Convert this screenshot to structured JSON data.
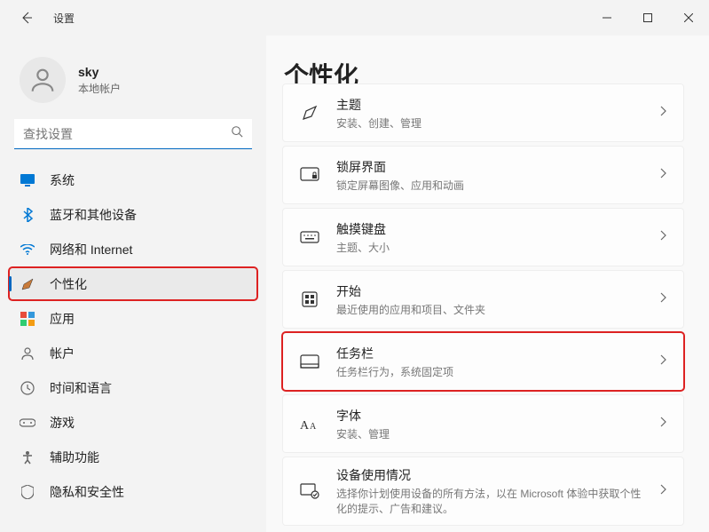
{
  "window": {
    "title": "设置"
  },
  "user": {
    "name": "sky",
    "account_type": "本地帐户"
  },
  "search": {
    "placeholder": "查找设置"
  },
  "sidebar": {
    "items": [
      {
        "label": "系统",
        "icon": "system-icon"
      },
      {
        "label": "蓝牙和其他设备",
        "icon": "bluetooth-icon"
      },
      {
        "label": "网络和 Internet",
        "icon": "wifi-icon"
      },
      {
        "label": "个性化",
        "icon": "personalization-icon",
        "active": true,
        "highlighted": true
      },
      {
        "label": "应用",
        "icon": "apps-icon"
      },
      {
        "label": "帐户",
        "icon": "accounts-icon"
      },
      {
        "label": "时间和语言",
        "icon": "time-language-icon"
      },
      {
        "label": "游戏",
        "icon": "gaming-icon"
      },
      {
        "label": "辅助功能",
        "icon": "accessibility-icon"
      },
      {
        "label": "隐私和安全性",
        "icon": "privacy-icon"
      }
    ]
  },
  "page": {
    "title": "个性化",
    "items": [
      {
        "title": "主题",
        "desc": "安装、创建、管理",
        "icon": "theme-icon"
      },
      {
        "title": "锁屏界面",
        "desc": "锁定屏幕图像、应用和动画",
        "icon": "lockscreen-icon"
      },
      {
        "title": "触摸键盘",
        "desc": "主题、大小",
        "icon": "keyboard-icon"
      },
      {
        "title": "开始",
        "desc": "最近使用的应用和项目、文件夹",
        "icon": "start-icon"
      },
      {
        "title": "任务栏",
        "desc": "任务栏行为，系统固定项",
        "icon": "taskbar-icon",
        "highlighted": true
      },
      {
        "title": "字体",
        "desc": "安装、管理",
        "icon": "font-icon"
      },
      {
        "title": "设备使用情况",
        "desc": "选择你计划使用设备的所有方法，以在 Microsoft 体验中获取个性化的提示、广告和建议。",
        "icon": "device-usage-icon"
      }
    ]
  }
}
